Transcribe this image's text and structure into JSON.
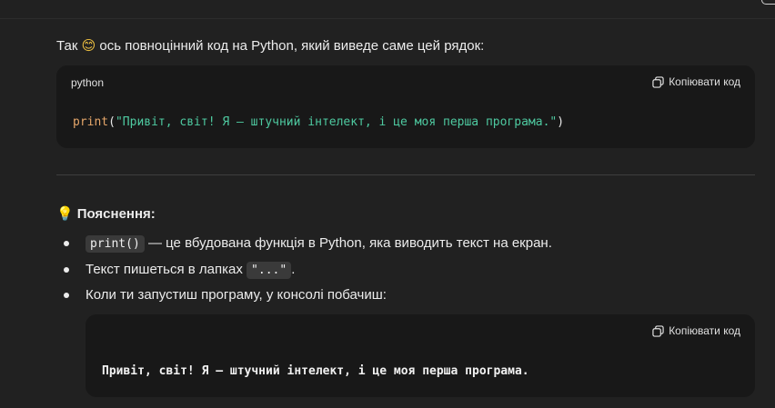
{
  "intro": {
    "text_before": "Так",
    "emoji": "😊",
    "text_after": "ось повноцінний код на Python, який виведе саме цей рядок:"
  },
  "code_block_1": {
    "language": "python",
    "copy_label": "Копіювати код",
    "code_fn": "print",
    "code_open": "(",
    "code_string": "\"Привіт, світ! Я — штучний інтелект, і це моя перша програма.\"",
    "code_close": ")"
  },
  "explanation": {
    "icon": "💡",
    "heading": "Пояснення:",
    "items": [
      {
        "code": "print()",
        "text": "— це вбудована функція в Python, яка виводить текст на екран."
      },
      {
        "text": "Текст пишеться в лапках",
        "code": "\"...\"",
        "suffix": "."
      },
      {
        "text": "Коли ти запустиш програму, у консолі побачиш:"
      }
    ]
  },
  "code_block_2": {
    "copy_label": "Копіювати код",
    "output": "Привіт, світ! Я — штучний інтелект, і це моя перша програма."
  },
  "colors": {
    "background": "#212121",
    "code_bg": "#181818",
    "string": "#4ec9a0",
    "function": "#e5a66a"
  }
}
